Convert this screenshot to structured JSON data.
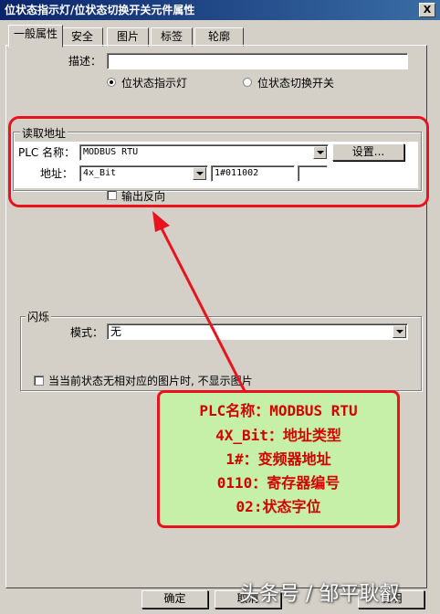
{
  "window": {
    "title": "位状态指示灯/位状态切换开关元件属性",
    "close": "X"
  },
  "tabs": [
    {
      "label": "一般属性"
    },
    {
      "label": "安全"
    },
    {
      "label": "图片"
    },
    {
      "label": "标签"
    },
    {
      "label": "轮廓"
    }
  ],
  "general": {
    "description_label": "描述：",
    "description_value": "",
    "mode_indicator": "位状态指示灯",
    "mode_switch": "位状态切换开关"
  },
  "read_address": {
    "group_label": "读取地址",
    "plc_name_label": "PLC 名称：",
    "plc_name_value": "MODBUS RTU",
    "settings_button": "设置...",
    "address_label": "地址：",
    "address_type_value": "4x_Bit",
    "address_value": "1#011002",
    "address_extra_value": "",
    "invert_output_label": "输出反向"
  },
  "blink": {
    "group_label": "闪烁",
    "mode_label": "模式：",
    "mode_value": "无",
    "no_image_label": "当当前状态无相对应的图片时, 不显示图片"
  },
  "footer": {
    "ok_button": "确定",
    "cancel_button": "取消",
    "help_button": "说明"
  },
  "callout": {
    "lines": [
      "PLC名称：MODBUS RTU",
      "4X_Bit：地址类型",
      "1#：变频器地址",
      "0110：寄存器编号",
      "02:状态字位"
    ]
  },
  "watermark": "头条号 / 邹平耿叡",
  "colors": {
    "annotation_red": "#e8131d",
    "callout_bg": "#c6efa7",
    "titlebar": "#0a246a"
  }
}
